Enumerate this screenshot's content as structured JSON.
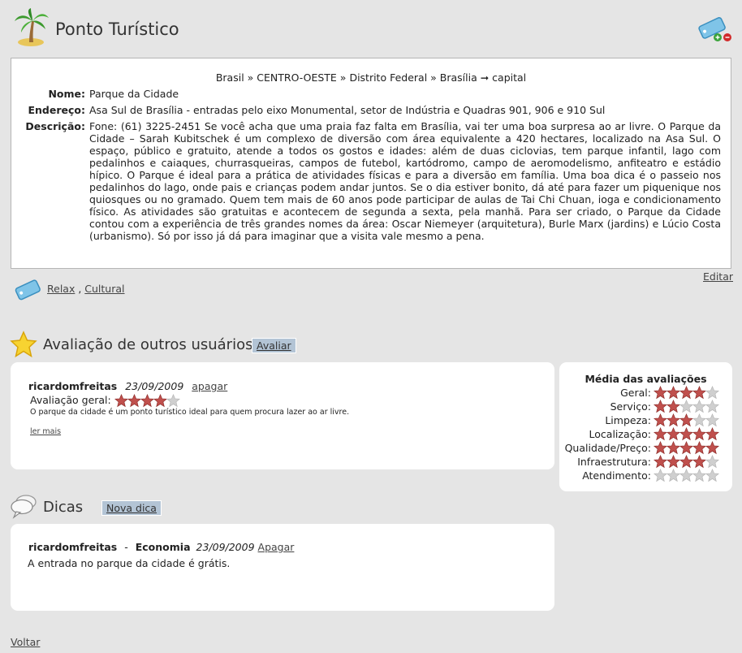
{
  "header": {
    "title": "Ponto Turístico",
    "icon": "palm-tree-icon",
    "tag_icon": "tag-add-remove-icon"
  },
  "info": {
    "breadcrumb": [
      "Brasil »",
      "CENTRO-OESTE »",
      "Distrito Federal »",
      "Brasília ➞ capital"
    ],
    "fields": [
      {
        "label": "Nome:",
        "value": "Parque da Cidade"
      },
      {
        "label": "Endereço:",
        "value": "Asa Sul de Brasília - entradas pelo eixo Monumental, setor de Indústria e Quadras 901, 906 e 910 Sul"
      },
      {
        "label": "Descrição:",
        "value": "Fone: (61) 3225-2451 Se você acha que uma praia faz falta em Brasília, vai ter uma boa surpresa ao ar livre. O Parque da Cidade – Sarah Kubitschek é um complexo de diversão com área equivalente a 420 hectares, localizado na Asa Sul. O espaço, público e gratuito, atende a todos os gostos e idades: além de duas ciclovias, tem parque infantil, lago com pedalinhos e caiaques, churrasqueiras, campos de futebol, kartódromo, campo de aeromodelismo, anfiteatro e estádio hípico. O Parque é ideal para a prática de atividades físicas e para a diversão em família. Uma boa dica é o passeio nos pedalinhos do lago, onde pais e crianças podem andar juntos. Se o dia estiver bonito, dá até para fazer um piquenique nos quiosques ou no gramado. Quem tem mais de 60 anos pode participar de aulas de Tai Chi Chuan, ioga e condicionamento físico. As atividades são gratuitas e acontecem de segunda a sexta, pela manhã. Para ser criado, o Parque da Cidade contou com a experiência de três grandes nomes da área: Oscar Niemeyer (arquitetura), Burle Marx (jardins) e Lúcio Costa (urbanismo). Só por isso já dá para imaginar que a visita vale mesmo a pena."
      }
    ],
    "edit_label": "Editar"
  },
  "tags": {
    "icon": "tag-icon",
    "items": [
      "Relax",
      "Cultural"
    ],
    "separator": " , "
  },
  "ratings": {
    "title": "Avaliação de outros usuários",
    "button": "Avaliar",
    "icon": "star-icon",
    "review": {
      "user": "ricardomfreitas",
      "date": "23/09/2009",
      "delete_label": "apagar",
      "overall_label": "Avaliação geral:",
      "overall_stars": 4,
      "text": "O parque da cidade é um ponto turístico ideal para quem procura lazer ao ar livre.",
      "more_label": "ler mais"
    },
    "averages": {
      "title": "Média das avaliações",
      "items": [
        {
          "label": "Geral:",
          "stars": 4
        },
        {
          "label": "Serviço:",
          "stars": 2
        },
        {
          "label": "Limpeza:",
          "stars": 3
        },
        {
          "label": "Localização:",
          "stars": 5
        },
        {
          "label": "Qualidade/Preço:",
          "stars": 5
        },
        {
          "label": "Infraestrutura:",
          "stars": 4
        },
        {
          "label": "Atendimento:",
          "stars": 0
        }
      ]
    }
  },
  "tips": {
    "title": "Dicas",
    "button": "Nova dica",
    "icon": "speech-bubble-icon",
    "tip": {
      "user": "ricardomfreitas",
      "dash": "-",
      "category": "Economia",
      "date": "23/09/2009",
      "delete_label": "Apagar",
      "text": "A entrada no parque da cidade é grátis."
    }
  },
  "footer": {
    "back_label": "Voltar"
  },
  "colors": {
    "star_on": "#c0504d",
    "star_off": "#cfcfcf",
    "button_bg": "#b3c4d5"
  }
}
